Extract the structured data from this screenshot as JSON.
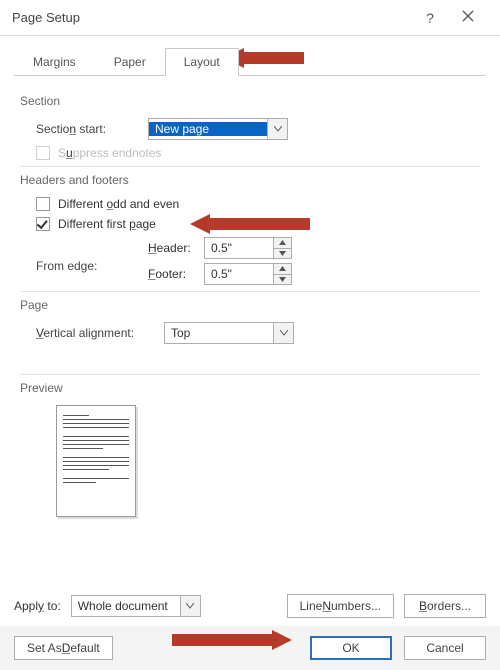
{
  "title": "Page Setup",
  "tabs": {
    "margins": "Margins",
    "paper": "Paper",
    "layout": "Layout"
  },
  "section": {
    "label": "Section",
    "start_label": "Section start:",
    "start_value": "New page",
    "suppress": "Suppress endnotes"
  },
  "hf": {
    "label": "Headers and footers",
    "odd_even": "Different odd and even",
    "first_page": "Different first page",
    "from_edge": "From edge:",
    "header_label": "Header:",
    "footer_label": "Footer:",
    "header_val": "0.5\"",
    "footer_val": "0.5\""
  },
  "page": {
    "label": "Page",
    "valign_label": "Vertical alignment:",
    "valign_value": "Top"
  },
  "preview_label": "Preview",
  "apply_to": {
    "label": "Apply to:",
    "value": "Whole document"
  },
  "buttons": {
    "line_numbers": "Line Numbers...",
    "borders": "Borders...",
    "default": "Set As Default",
    "ok": "OK",
    "cancel": "Cancel"
  }
}
